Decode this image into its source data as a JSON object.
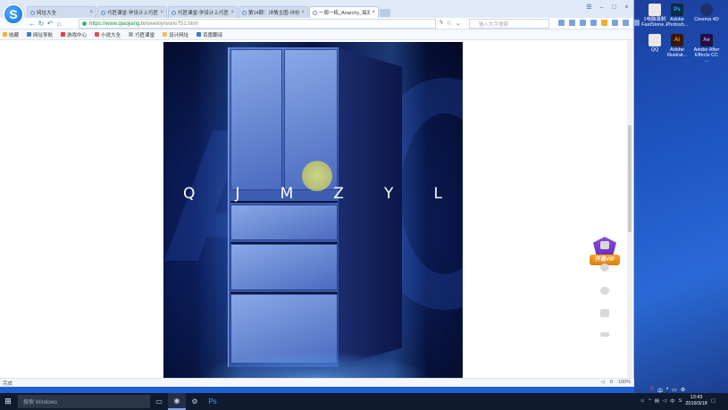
{
  "browser": {
    "tabs": [
      {
        "label": "网址大全",
        "active": false
      },
      {
        "label": "巧匠课堂-学设计上巧匠",
        "active": false
      },
      {
        "label": "巧匠课堂-学设计上巧匠",
        "active": false
      },
      {
        "label": "第14期：详情主图-详份",
        "active": false
      },
      {
        "label": "一周一练_Anarchy_每双",
        "active": true
      }
    ],
    "address": {
      "host": "https://www.qiaojiang.tv",
      "path": "/weekly/work/751.html"
    },
    "search_placeholder": "输入文字搜索",
    "bookmarks": [
      "收藏",
      "网址导航",
      "游戏中心",
      "小说大全",
      "巧匠课堂",
      "设计网址",
      "百度翻译"
    ],
    "status_left": "完成",
    "status_right": [
      "0",
      "100%"
    ]
  },
  "poster": {
    "letters": [
      "Q",
      "J",
      "M",
      "Z",
      "Y",
      "L"
    ]
  },
  "floating": {
    "vip_label": "开通VIP"
  },
  "desktop_icons": [
    {
      "label": "1电脑录制FastStone...",
      "glyph": "",
      "color": "#e8e8e8"
    },
    {
      "label": "Adobe Photosh...",
      "glyph": "Ps",
      "color": "#0b2a4a"
    },
    {
      "label": "Cinema 4D",
      "glyph": "",
      "color": "#1f2f6a"
    },
    {
      "label": "QQ",
      "glyph": "",
      "color": "#e8e8e8"
    },
    {
      "label": "Adobe Illustrat...",
      "glyph": "Ai",
      "color": "#3b1600"
    },
    {
      "label": "Adobe After Effects CC ...",
      "glyph": "Ae",
      "color": "#1f0f3d"
    }
  ],
  "taskbar": {
    "search_placeholder": "搜索 Windows",
    "clock_time": "13:43",
    "clock_date": "2019/3/18",
    "tray_lang": "中"
  }
}
